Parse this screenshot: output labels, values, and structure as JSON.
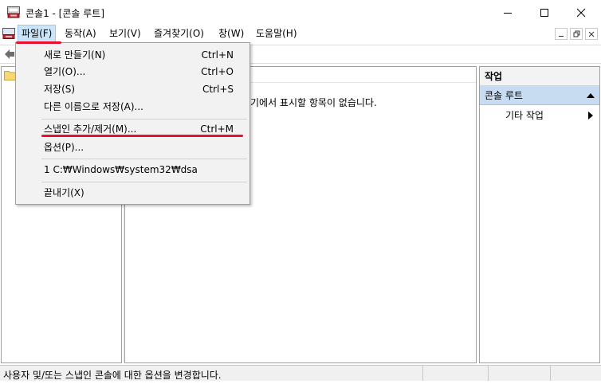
{
  "window": {
    "title": "콘솔1 - [콘솔 루트]",
    "icon": "mmc-console-icon",
    "controls": [
      "minimize-icon",
      "maximize-icon",
      "close-icon"
    ]
  },
  "menubar": {
    "items": [
      "파일(F)",
      "동작(A)",
      "보기(V)",
      "즐겨찾기(O)",
      "창(W)",
      "도움말(H)"
    ],
    "active_index": 0
  },
  "file_menu": {
    "items": [
      {
        "label": "새로 만들기(N)",
        "shortcut": "Ctrl+N"
      },
      {
        "label": "열기(O)...",
        "shortcut": "Ctrl+O"
      },
      {
        "label": "저장(S)",
        "shortcut": "Ctrl+S"
      },
      {
        "label": "다른 이름으로 저장(A)...",
        "shortcut": ""
      },
      {
        "label": "스냅인 추가/제거(M)...",
        "shortcut": "Ctrl+M"
      },
      {
        "label": "옵션(P)...",
        "shortcut": ""
      },
      {
        "label": "1 C:₩Windows₩system32₩dsa",
        "shortcut": ""
      },
      {
        "label": "끝내기(X)",
        "shortcut": ""
      }
    ]
  },
  "center": {
    "message": "기에서 표시할 항목이 없습니다."
  },
  "actions_pane": {
    "title": "작업",
    "section": "콘솔 루트",
    "item": "기타 작업"
  },
  "statusbar": {
    "text": "사용자 및/또는 스냅인 콘솔에 대한 옵션을 변경합니다."
  },
  "colors": {
    "highlight_underline": "#e8102e",
    "menu_active": "#cce4f7",
    "actions_section": "#c7dcf0"
  }
}
